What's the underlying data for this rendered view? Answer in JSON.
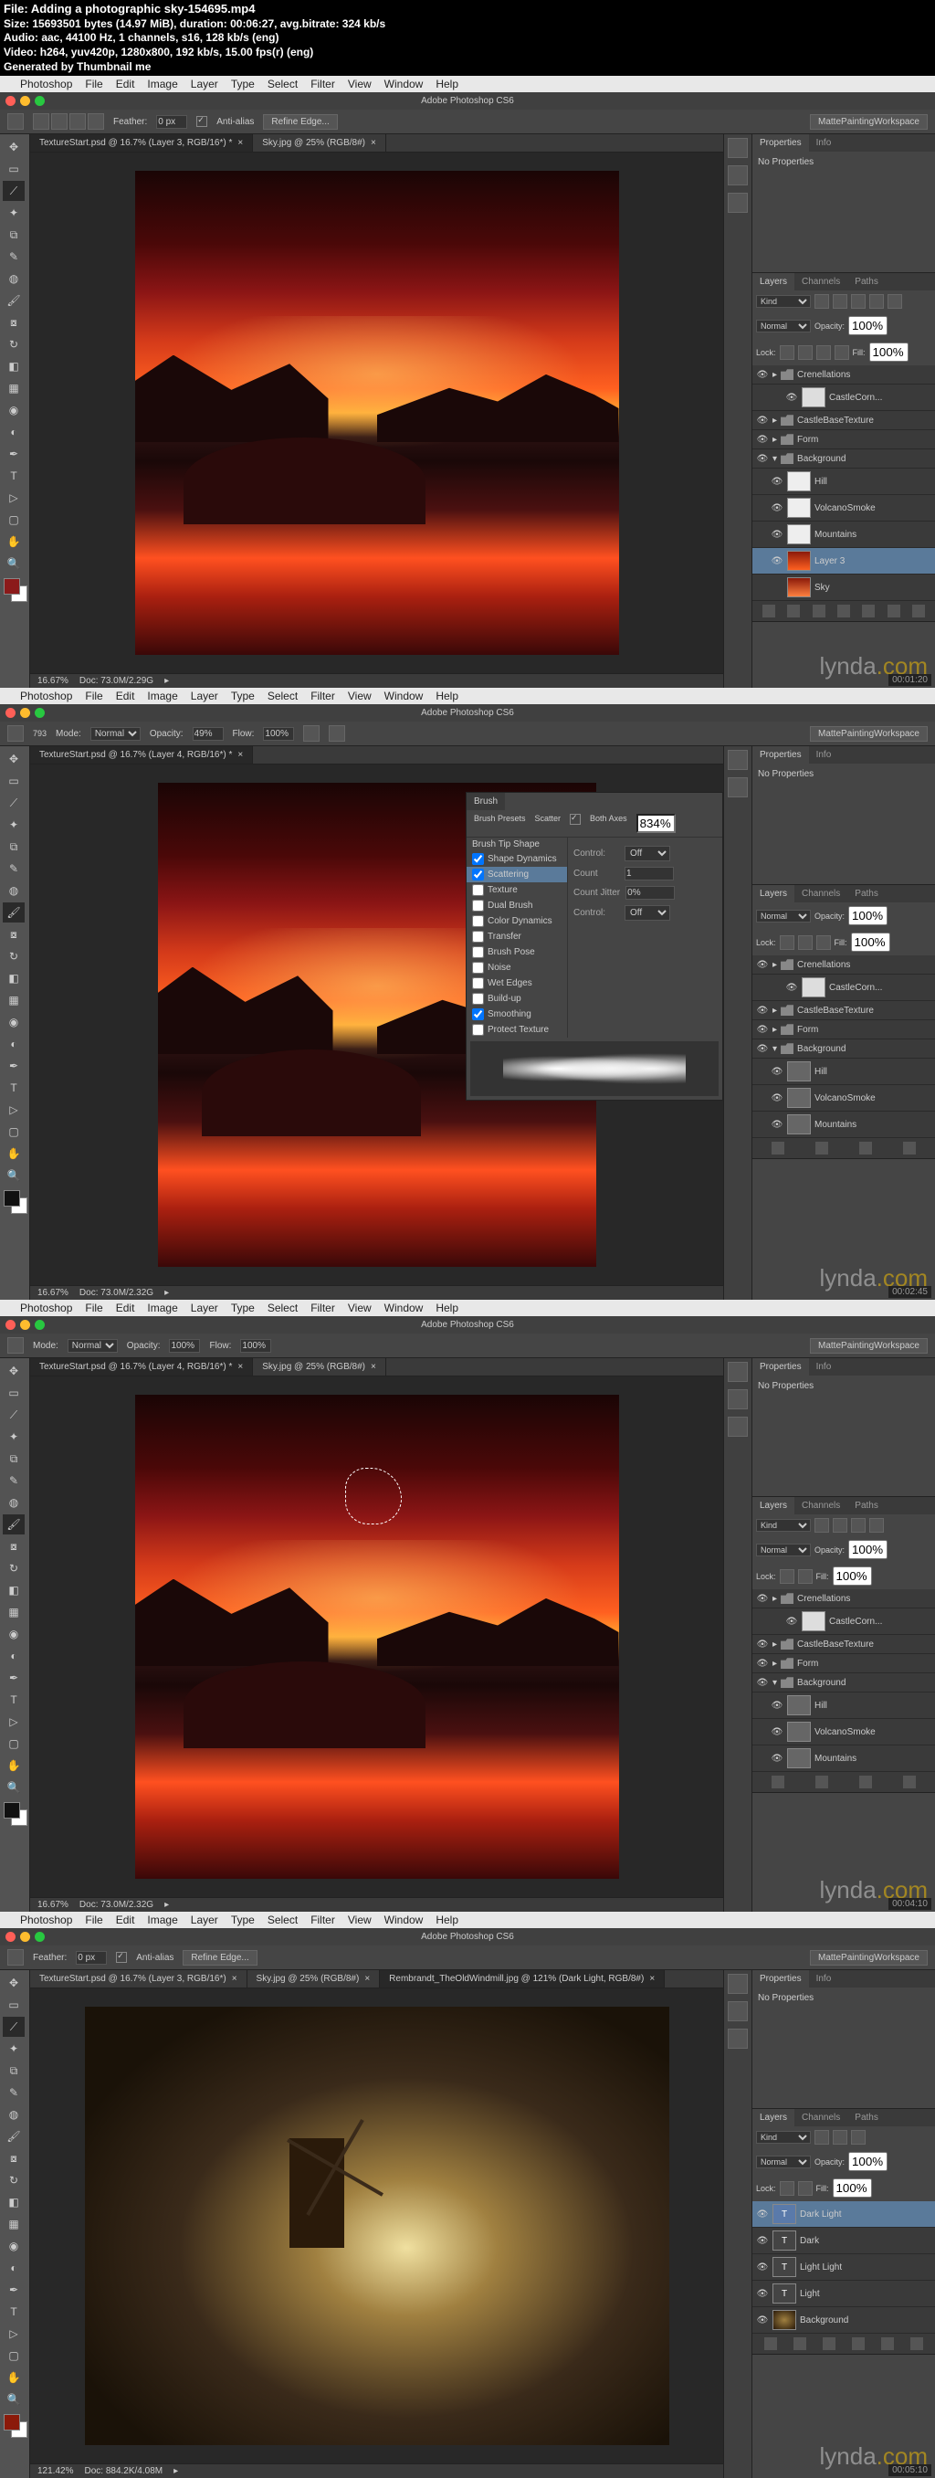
{
  "meta": {
    "file": "File: Adding a photographic sky-154695.mp4",
    "size": "Size: 15693501 bytes (14.97 MiB), duration: 00:06:27, avg.bitrate: 324 kb/s",
    "audio": "Audio: aac, 44100 Hz, 1 channels, s16, 128 kb/s (eng)",
    "video": "Video: h264, yuv420p, 1280x800, 192 kb/s, 15.00 fps(r) (eng)",
    "gen": "Generated by Thumbnail me"
  },
  "menu": {
    "apple": "",
    "items": [
      "Photoshop",
      "File",
      "Edit",
      "Image",
      "Layer",
      "Type",
      "Select",
      "Filter",
      "View",
      "Window",
      "Help"
    ]
  },
  "title": "Adobe Photoshop CS6",
  "workspace": "MattePaintingWorkspace",
  "optbar1": {
    "feather_lbl": "Feather:",
    "feather": "0 px",
    "aa": "Anti-alias",
    "refine": "Refine Edge..."
  },
  "optbar2": {
    "mode_lbl": "Mode:",
    "mode": "Normal",
    "opacity_lbl": "Opacity:",
    "opacity": "49%",
    "flow_lbl": "Flow:",
    "flow": "100%",
    "size": "793"
  },
  "optbar3": {
    "mode_lbl": "Mode:",
    "mode": "Normal",
    "opacity_lbl": "Opacity:",
    "opacity": "100%",
    "flow_lbl": "Flow:",
    "flow": "100%"
  },
  "tabs1": {
    "a": "TextureStart.psd @ 16.7% (Layer 3, RGB/16*) *",
    "b": "Sky.jpg @ 25% (RGB/8#)"
  },
  "tabs2": {
    "a": "TextureStart.psd @ 16.7% (Layer 4, RGB/16*) *"
  },
  "tabs3": {
    "a": "TextureStart.psd @ 16.7% (Layer 4, RGB/16*) *",
    "b": "Sky.jpg @ 25% (RGB/8#)"
  },
  "tabs4": {
    "a": "TextureStart.psd @ 16.7% (Layer 3, RGB/16*)",
    "b": "Sky.jpg @ 25% (RGB/8#)",
    "c": "Rembrandt_TheOldWindmill.jpg @ 121% (Dark Light, RGB/8#)"
  },
  "status1": {
    "zoom": "16.67%",
    "doc": "Doc: 73.0M/2.29G"
  },
  "status2": {
    "zoom": "16.67%",
    "doc": "Doc: 73.0M/2.32G"
  },
  "status4": {
    "zoom": "121.42%",
    "doc": "Doc: 884.2K/4.08M"
  },
  "props": {
    "tab1": "Properties",
    "tab2": "Info",
    "noprops": "No Properties"
  },
  "layers_panel": {
    "tab1": "Layers",
    "tab2": "Channels",
    "tab3": "Paths",
    "kind": "Kind",
    "blend": "Normal",
    "opacity_lbl": "Opacity:",
    "opacity": "100%",
    "lock_lbl": "Lock:",
    "fill_lbl": "Fill:",
    "fill": "100%"
  },
  "layers1": [
    "Crenellations",
    "CastleCorn...",
    "CastleBaseTexture",
    "Form",
    "Background",
    "Hill",
    "VolcanoSmoke",
    "Mountains",
    "Layer 3",
    "Sky"
  ],
  "layers2": [
    "Crenellations",
    "CastleCorn...",
    "CastleBaseTexture",
    "Form",
    "Background",
    "Hill",
    "VolcanoSmoke",
    "Mountains"
  ],
  "layers4": [
    "Dark Light",
    "Dark",
    "Light Light",
    "Light",
    "Background"
  ],
  "brush": {
    "title": "Brush",
    "tabs": [
      "Brush Presets",
      "Scatter",
      "Both Axes",
      "834%"
    ],
    "left": [
      "Brush Tip Shape",
      "Shape Dynamics",
      "Scattering",
      "Texture",
      "Dual Brush",
      "Color Dynamics",
      "Transfer",
      "Brush Pose",
      "Noise",
      "Wet Edges",
      "Build-up",
      "Smoothing",
      "Protect Texture"
    ],
    "right": {
      "control": "Control:",
      "off": "Off",
      "count": "Count",
      "count_v": "1",
      "cj": "Count Jitter",
      "cj_v": "0%"
    }
  },
  "watermark": {
    "a": "lynda",
    "b": ".com"
  },
  "tc": {
    "t1": "00:01:20",
    "t2": "00:02:45",
    "t3": "00:04:10",
    "t4": "00:05:10"
  }
}
